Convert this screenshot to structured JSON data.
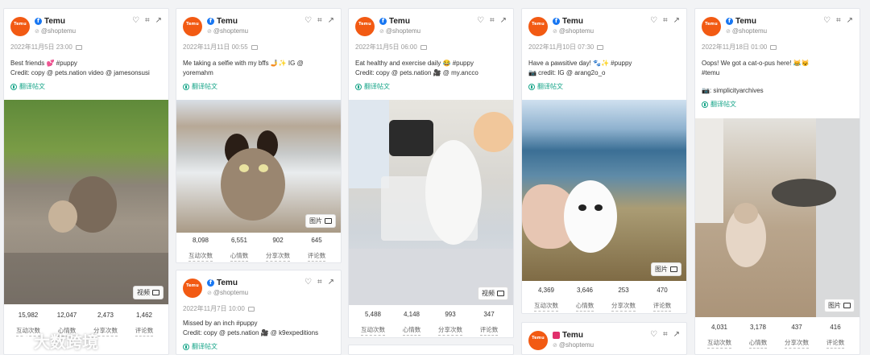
{
  "account": {
    "name": "Temu",
    "handle": "@shoptemu",
    "avatar_text": "Temu"
  },
  "header_icons": [
    "heart-icon",
    "tag-icon",
    "share-icon"
  ],
  "translate_label": "翻译帖文",
  "stat_labels": [
    "互动次数",
    "心情数",
    "分享次数",
    "评论数"
  ],
  "watermark": "大数跨境",
  "posts": [
    {
      "date": "2022年11月5日 23:00",
      "media_type": "video",
      "line1": "Best friends 💕 #puppy",
      "line2": "Credit: copy @ pets.nation video @ jamesonsusi",
      "badge": "视频",
      "stats": [
        "15,982",
        "12,047",
        "2,473",
        "1,462"
      ]
    },
    {
      "date": "2022年11月11日 00:55",
      "media_type": "photo",
      "line1": "Me taking a selfie with my bffs 🤳✨ IG @",
      "line2": "yoremahm",
      "badge": "图片",
      "stats": [
        "8,098",
        "6,551",
        "902",
        "645"
      ]
    },
    {
      "date": "2022年11月7日 10:00",
      "media_type": "video",
      "line1": "Missed by an inch   #puppy",
      "line2": "Credit: copy @ pets.nation 🎥 @ k9expeditions"
    },
    {
      "date": "2022年11月5日 06:00",
      "media_type": "video",
      "line1": "Eat healthy and exercise daily 😂 #puppy",
      "line2": "Credit: copy @ pets.nation 🎥 @ my.ancco",
      "badge": "视频",
      "stats": [
        "5,488",
        "4,148",
        "993",
        "347"
      ]
    },
    {
      "date": "2022年11月10日 07:30",
      "media_type": "photo",
      "line1": "Have a pawsitive day! 🐾✨ #puppy",
      "line2": "📷 credit: IG @ arang2o_o",
      "badge": "图片",
      "stats": [
        "4,369",
        "3,646",
        "253",
        "470"
      ]
    },
    {
      "date": "2022年11月18日 01:00",
      "media_type": "photo",
      "line1": "Oops! We got a cat-o-pus here! 😹😼",
      "line2": "#temu",
      "line3": "📷: simplicityarchives",
      "badge": "图片",
      "stats": [
        "4,031",
        "3,178",
        "437",
        "416"
      ]
    }
  ]
}
